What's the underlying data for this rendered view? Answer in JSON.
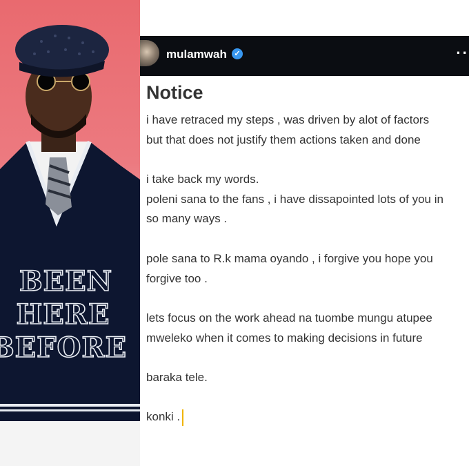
{
  "post": {
    "username": "mulamwah",
    "verified_icon": "verified-badge-icon",
    "more_icon": "more-options-icon",
    "title": "Notice",
    "lines": [
      "i have retraced my steps , was driven by alot of factors",
      "but that does not justify them actions taken and done",
      "",
      "i take back my words.",
      "poleni sana to the fans , i have dissapointed lots of you in",
      "so many ways .",
      "",
      "pole sana to R.k mama oyando , i forgive you hope you",
      "forgive too .",
      "",
      "lets focus on the work ahead na tuombe mungu atupee",
      "mweleko when it comes to making decisions in future",
      "",
      "baraka tele.",
      "",
      "konki ."
    ]
  },
  "photo": {
    "sweater_lines": [
      "BEEN",
      "HERE",
      "BEFORE"
    ]
  },
  "colors": {
    "header_bg": "#0b0d12",
    "verified_blue": "#3897f0",
    "text": "#333333",
    "cursor": "#f0b400"
  }
}
